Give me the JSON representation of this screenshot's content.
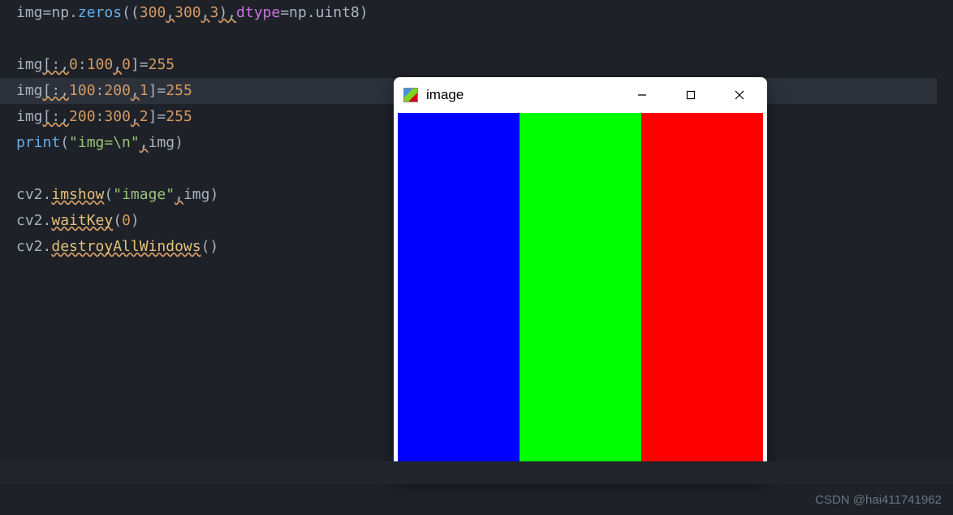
{
  "code": {
    "l1": {
      "t1": "img",
      "t2": "=",
      "t3": "np",
      "t4": ".",
      "t5": "zeros",
      "t6": "((",
      "t7": "300",
      "t8": ",",
      "t9": "300",
      "t10": ",",
      "t11": "3",
      "t12": "),",
      "t13": "dtype",
      "t14": "=",
      "t15": "np",
      "t16": ".",
      "t17": "uint8",
      "t18": ")"
    },
    "l3": {
      "t1": "img",
      "t2": "[:,",
      "t3": "0",
      "t4": ":",
      "t5": "100",
      "t6": ",",
      "t7": "0",
      "t8": "]=",
      "t9": "255"
    },
    "l4": {
      "t1": "img",
      "t2": "[:,",
      "t3": "100",
      "t4": ":",
      "t5": "200",
      "t6": ",",
      "t7": "1",
      "t8": "]=",
      "t9": "255"
    },
    "l5": {
      "t1": "img",
      "t2": "[:,",
      "t3": "200",
      "t4": ":",
      "t5": "300",
      "t6": ",",
      "t7": "2",
      "t8": "]=",
      "t9": "255"
    },
    "l6": {
      "t1": "print",
      "t2": "(",
      "t3": "\"img=\\n\"",
      "t4": ",",
      "t5": "img",
      "t6": ")"
    },
    "l8": {
      "t1": "cv2",
      "t2": ".",
      "t3": "imshow",
      "t4": "(",
      "t5": "\"image\"",
      "t6": ",",
      "t7": "img",
      "t8": ")"
    },
    "l9": {
      "t1": "cv2",
      "t2": ".",
      "t3": "waitKey",
      "t4": "(",
      "t5": "0",
      "t6": ")"
    },
    "l10": {
      "t1": "cv2",
      "t2": ".",
      "t3": "destroyAllWindows",
      "t4": "()"
    }
  },
  "dialog": {
    "title": "image"
  },
  "canvas": {
    "stripes": [
      "blue",
      "green",
      "red"
    ],
    "colors": {
      "blue": "#0000ff",
      "green": "#00ff00",
      "red": "#ff0000"
    }
  },
  "watermark": "CSDN @hai411741962"
}
